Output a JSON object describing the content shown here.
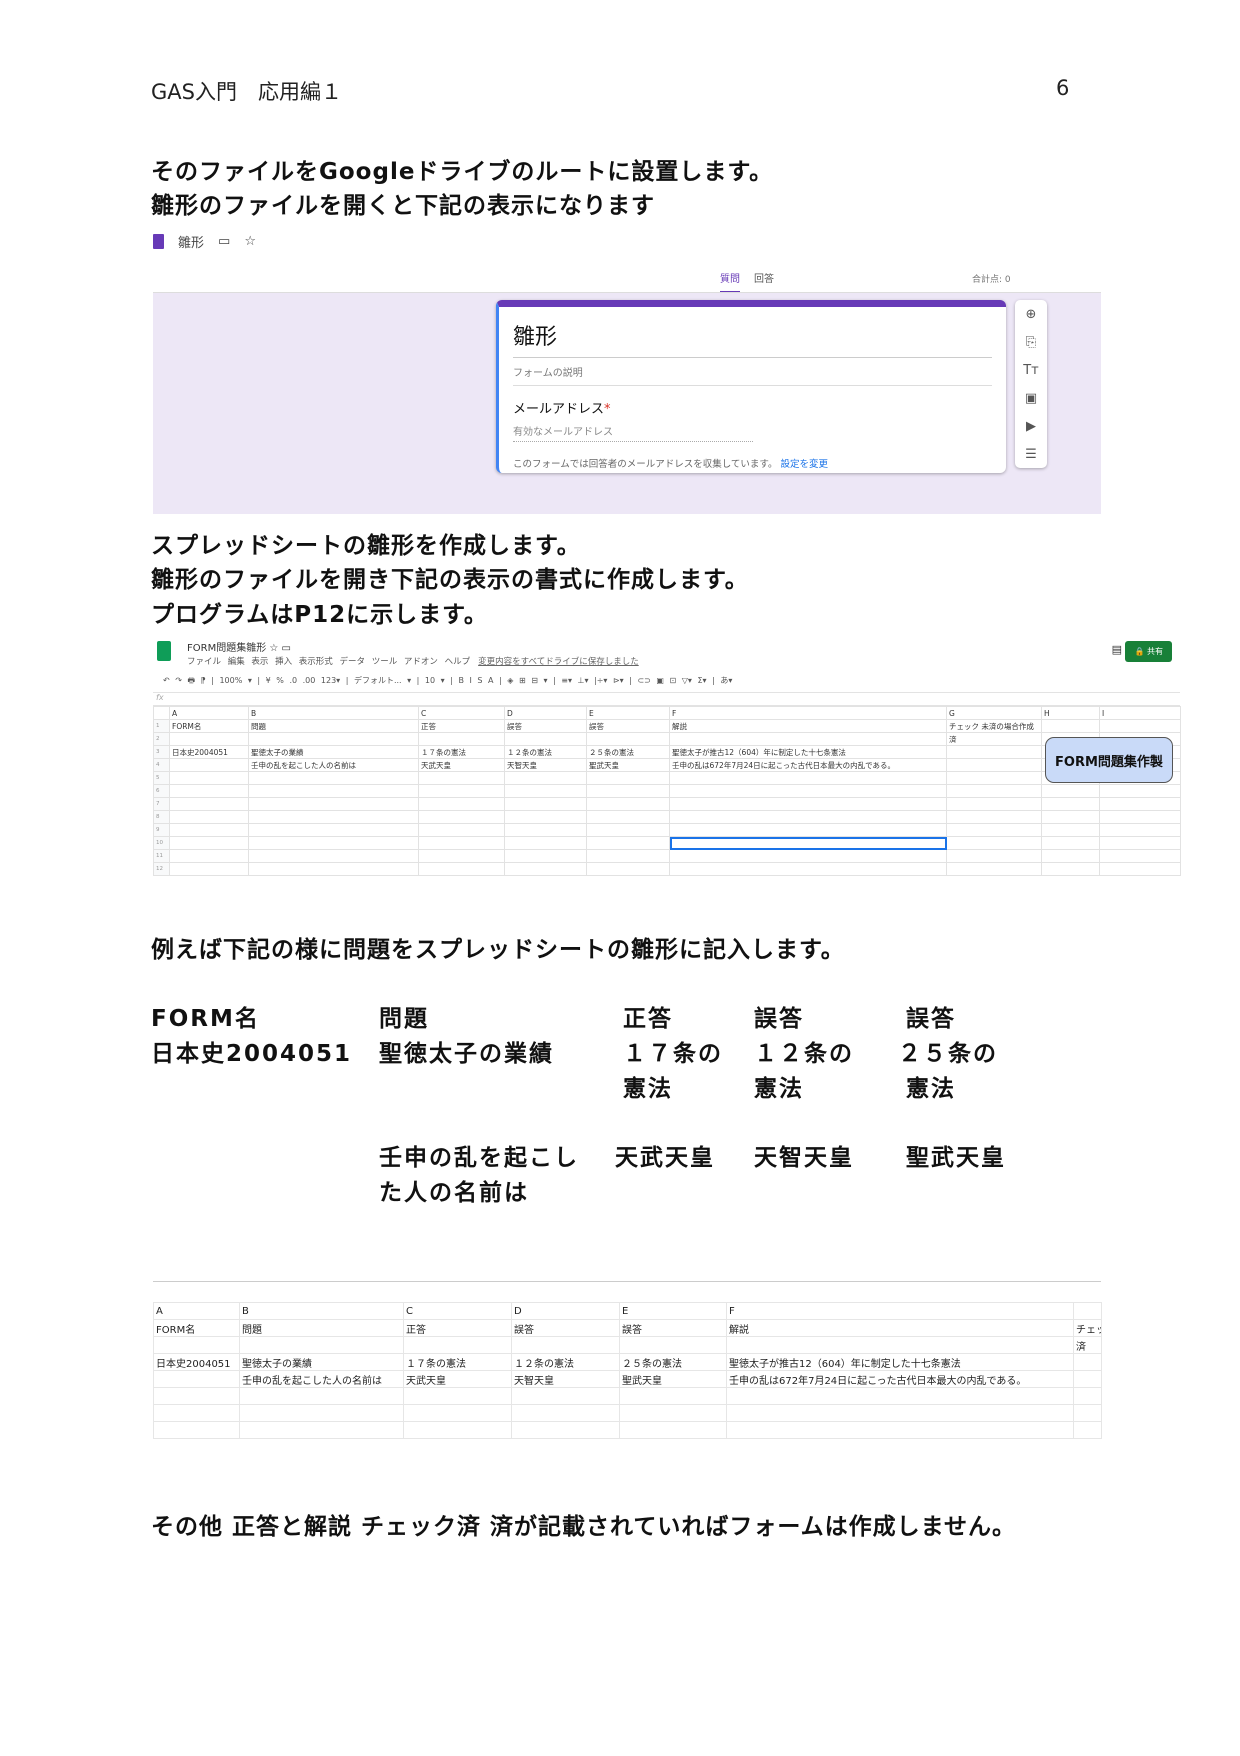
{
  "header": {
    "title": "GAS入門　応用編１",
    "page": "6"
  },
  "text": {
    "p1": "そのファイルをGoogleドライブのルートに設置します。",
    "p2": "雛形のファイルを開くと下記の表示になります",
    "p3": "スプレッドシートの雛形を作成します。",
    "p4": "雛形のファイルを開き下記の表示の書式に作成します。",
    "p5": "プログラムはP12に示します。",
    "p6": "例えば下記の様に問題をスプレッドシートの雛形に記入します。",
    "p7": "その他 正答と解説 チェック済 済が記載されていればフォームは作成しません。"
  },
  "form": {
    "doc_name": "雛形",
    "tabs": [
      "質問",
      "回答"
    ],
    "score": "合計点: 0",
    "title": "雛形",
    "description": "フォームの説明",
    "question": "メールアドレス",
    "required": "*",
    "placeholder": "有効なメールアドレス",
    "note": "このフォームでは回答者のメールアドレスを収集しています。",
    "note_link": "設定を変更"
  },
  "sheet": {
    "title": "FORM問題集雛形",
    "menu": "ファイル 編集 表示 挿入 表示形式 データ ツール アドオン ヘルプ",
    "saved": "変更内容をすべてドライブに保存しました",
    "share": "🔒 共有",
    "toolbar": "↶ ↷ 🖶 ⁋ | 100% ▾ | ¥ % .0 .00 123▾ | デフォルト... ▾ | 10 ▾ | B I S A | ◈ ⊞ ⊟ ▾ | ≡▾ ⊥▾ |÷▾ ⊳▾ | ⊂⊃ ▣ ⊡ ▽▾ Σ▾ | あ▾",
    "fx": "fx",
    "cols": [
      "",
      "A",
      "B",
      "C",
      "D",
      "E",
      "F",
      "G",
      "H",
      "I"
    ],
    "rows": [
      [
        "1",
        "FORM名",
        "問題",
        "正答",
        "誤答",
        "誤答",
        "解説",
        "チェック 未済の場合作成",
        "",
        ""
      ],
      [
        "2",
        "",
        "",
        "",
        "",
        "",
        "",
        "済",
        "",
        ""
      ],
      [
        "3",
        "日本史2004051",
        "聖徳太子の業績",
        "１７条の憲法",
        "１２条の憲法",
        "２５条の憲法",
        "聖徳太子が推古12（604）年に制定した十七条憲法",
        "",
        "",
        ""
      ],
      [
        "4",
        "",
        "壬申の乱を起こした人の名前は",
        "天武天皇",
        "天智天皇",
        "聖武天皇",
        "壬申の乱は672年7月24日に起こった古代日本最大の内乱である。",
        "",
        "",
        ""
      ],
      [
        "5",
        "",
        "",
        "",
        "",
        "",
        "",
        "",
        "",
        ""
      ],
      [
        "6",
        "",
        "",
        "",
        "",
        "",
        "",
        "",
        "",
        ""
      ],
      [
        "7",
        "",
        "",
        "",
        "",
        "",
        "",
        "",
        "",
        ""
      ],
      [
        "8",
        "",
        "",
        "",
        "",
        "",
        "",
        "",
        "",
        ""
      ],
      [
        "9",
        "",
        "",
        "",
        "",
        "",
        "",
        "",
        "",
        ""
      ],
      [
        "10",
        "",
        "",
        "",
        "",
        "",
        "",
        "",
        "",
        ""
      ],
      [
        "11",
        "",
        "",
        "",
        "",
        "",
        "",
        "",
        "",
        ""
      ],
      [
        "12",
        "",
        "",
        "",
        "",
        "",
        "",
        "",
        "",
        ""
      ]
    ],
    "button": "FORM問題集作製"
  },
  "example": {
    "headers": [
      "FORM名",
      "問題",
      "正答",
      "誤答",
      "誤答"
    ],
    "row1": [
      "日本史2004051",
      "聖徳太子の業績",
      "１７条の",
      "１２条の",
      "２５条の"
    ],
    "row1b": [
      "憲法",
      "憲法",
      "憲法"
    ],
    "row2a": "壬申の乱を起こし",
    "row2b": "た人の名前は",
    "row2": [
      "天武天皇",
      "天智天皇",
      "聖武天皇"
    ]
  },
  "sheet2": {
    "cols": [
      "A",
      "B",
      "C",
      "D",
      "E",
      "F",
      ""
    ],
    "rows": [
      [
        "FORM名",
        "問題",
        "正答",
        "誤答",
        "誤答",
        "解説",
        "チェッ"
      ],
      [
        "",
        "",
        "",
        "",
        "",
        "",
        "済"
      ],
      [
        "日本史2004051",
        "聖徳太子の業績",
        "１７条の憲法",
        "１２条の憲法",
        "２５条の憲法",
        "聖徳太子が推古12（604）年に制定した十七条憲法",
        ""
      ],
      [
        "",
        "壬申の乱を起こした人の名前は",
        "天武天皇",
        "天智天皇",
        "聖武天皇",
        "壬申の乱は672年7月24日に起こった古代日本最大の内乱である。",
        ""
      ],
      [
        "",
        "",
        "",
        "",
        "",
        "",
        ""
      ],
      [
        "",
        "",
        "",
        "",
        "",
        "",
        ""
      ],
      [
        "",
        "",
        "",
        "",
        "",
        "",
        ""
      ]
    ]
  }
}
